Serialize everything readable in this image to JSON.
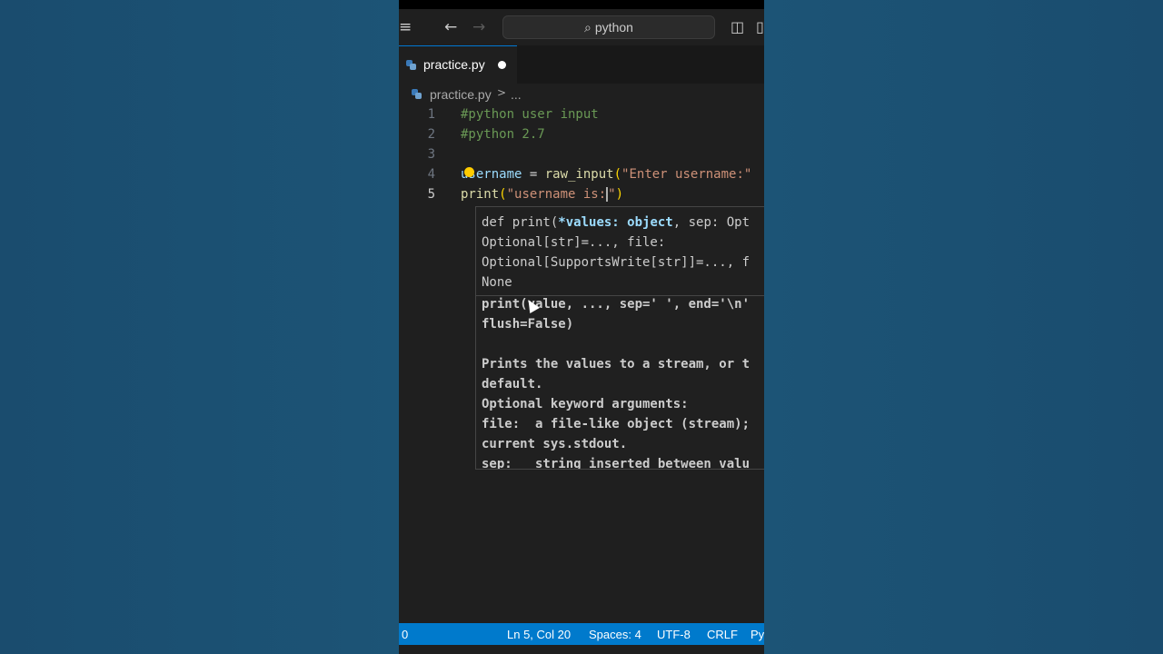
{
  "titlebar": {
    "search_text": "python"
  },
  "tab": {
    "label": "practice.py"
  },
  "breadcrumb": {
    "file": "practice.py",
    "separator": ">",
    "more": "..."
  },
  "lines": [
    {
      "num": "1",
      "text": "#python user input"
    },
    {
      "num": "2",
      "text": "#python 2.7"
    },
    {
      "num": "3",
      "text": ""
    },
    {
      "num": "4",
      "text": "username = raw_input(\"Enter username:\""
    },
    {
      "num": "5",
      "text": "print(\"username is:\")"
    }
  ],
  "code": {
    "l4_var": "username",
    "l4_eq": " = ",
    "l4_fn": "raw_input",
    "l4_open": "(",
    "l4_str": "\"Enter username:\"",
    "l5_fn": "print",
    "l5_open": "(",
    "l5_str": "\"username is:",
    "l5_str_end": "\"",
    "l5_close": ")"
  },
  "hover": {
    "sig1_a": "def print(",
    "sig1_b": "*values: object",
    "sig1_c": ", sep: Opt",
    "sig2": "Optional[str]=..., file:",
    "sig3": "Optional[SupportsWrite[str]]=..., f",
    "sig4": "None",
    "doc1": "print(value, ..., sep=' ', end='\\n'",
    "doc2": "flush=False)",
    "doc3": "",
    "doc4": "Prints the values to a stream, or t",
    "doc5": "default.",
    "doc6": "Optional keyword arguments:",
    "doc7": "file:  a file-like object (stream);",
    "doc8": "current sys.stdout.",
    "doc9": "sep:   string inserted between valu"
  },
  "statusbar": {
    "errors": "0",
    "position": "Ln 5, Col 20",
    "spaces": "Spaces: 4",
    "encoding": "UTF-8",
    "eol": "CRLF",
    "language": "Py"
  },
  "colors": {
    "statusbar": "#007acc",
    "background": "#1c5476",
    "editor": "#1f1f1f"
  }
}
